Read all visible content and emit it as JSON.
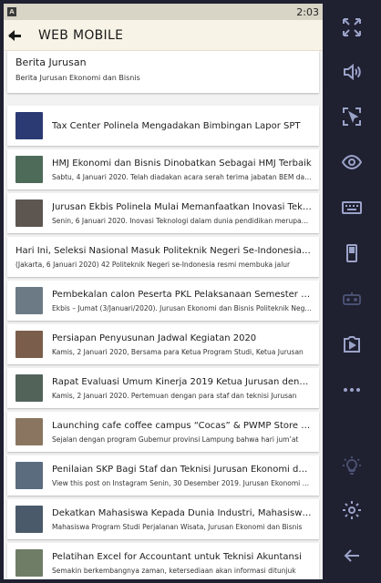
{
  "status": {
    "time": "2:03",
    "icon_letter": "A"
  },
  "appbar": {
    "title": "WEB MOBILE"
  },
  "section": {
    "title": "Berita Jurusan",
    "subtitle": "Berita Jurusan Ekonomi dan Bisnis"
  },
  "news": [
    {
      "title": "Tax Center Polinela Mengadakan Bimbingan Lapor SPT",
      "summary": "",
      "thumb": "#2b3a73"
    },
    {
      "title": "HMJ Ekonomi dan Bisnis Dinobatkan Sebagai HMJ Terbaik",
      "summary": "Sabtu, 4 Januari 2020. Telah diadakan acara serah terima jabatan BEM dan HMJ",
      "thumb": "#4d6b58"
    },
    {
      "title": "Jurusan Ekbis Polinela Mulai Memanfaatkan Inovasi Teknologi",
      "summary": "Senin, 6 Januari 2020. Inovasi Teknologi dalam dunia pendidikan merupakan",
      "thumb": "#5d5550"
    },
    {
      "title": "Hari Ini, Seleksi Nasional Masuk Politeknik Negeri Se-Indonesia Dibuka",
      "summary": "(Jakarta, 6 Januari 2020) 42 Politeknik Negeri se-Indonesia resmi membuka jalur",
      "thumb": ""
    },
    {
      "title": "Pembekalan calon Peserta PKL Pelaksanaan Semester Genap",
      "summary": "Ekbis – Jumat (3/Januari/2020). Jurusan Ekonomi dan Bisnis Politeknik Negeri",
      "thumb": "#6c7a86"
    },
    {
      "title": "Persiapan Penyusunan Jadwal Kegiatan 2020",
      "summary": "Kamis, 2 Januari 2020, Bersama para Ketua Program Studi, Ketua Jurusan",
      "thumb": "#7a5e4b"
    },
    {
      "title": "Rapat Evaluasi Umum Kinerja 2019 Ketua Jurusan dengan Staf",
      "summary": "Kamis, 2 Januari 2020. Pertemuan dengan para staf dan teknisi Jurusan",
      "thumb": "#52635a"
    },
    {
      "title": "Launching cafe coffee campus “Cocas” & PWMP Store Polinela",
      "summary": "Sejalan dengan program Gubernur provinsi Lampung bahwa hari jum’at",
      "thumb": "#8a7660"
    },
    {
      "title": "Penilaian SKP Bagi Staf dan Teknisi Jurusan Ekonomi dan Bisnis",
      "summary": "View this post on Instagram Senin, 30 Desember 2019. Jurusan Ekonomi dan",
      "thumb": "#5b6c7f"
    },
    {
      "title": "Dekatkan Mahasiswa Kepada Dunia Industri, Mahasiswa Perjalanan Wisata",
      "summary": "Mahasiswa Program Studi Perjalanan Wisata, Jurusan Ekonomi dan Bisnis",
      "thumb": "#4a5a6a"
    },
    {
      "title": "Pelatihan Excel for Accountant untuk Teknisi Akuntansi",
      "summary": "Semakin berkembangnya zaman, ketersediaan akan informasi ditunjuk",
      "thumb": "#6f7d66"
    }
  ],
  "sidebar_icons": [
    "fullscreen-icon",
    "volume-icon",
    "screenshot-icon",
    "eye-icon",
    "keyboard-icon",
    "phone-rotate-icon",
    "gamepad-icon",
    "media-import-icon",
    "more-icon",
    "light-icon",
    "settings-icon",
    "back-icon"
  ]
}
